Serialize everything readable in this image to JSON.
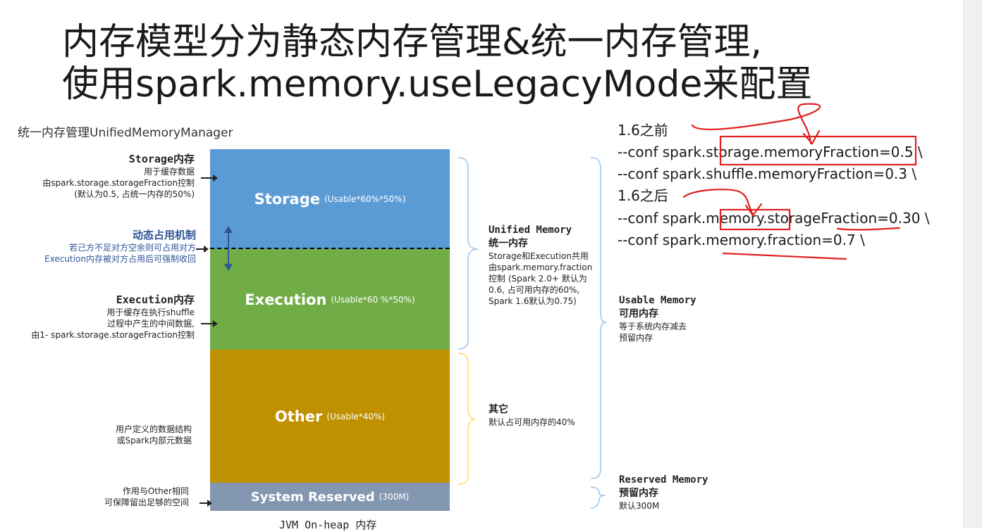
{
  "title": {
    "line1": "内存模型分为静态内存管理&统一内存管理,",
    "line2": "使用spark.memory.useLegacyMode来配置"
  },
  "diagram": {
    "caption": "统一内存管理UnifiedMemoryManager",
    "blocks": {
      "storage": {
        "name": "Storage",
        "note": "(Usable*60%*50%)"
      },
      "execution": {
        "name": "Execution",
        "note": "(Usable*60 %*50%)"
      },
      "other": {
        "name": "Other",
        "note": "(Usable*40%)"
      },
      "reserved": {
        "name": "System Reserved",
        "note": "(300M)"
      }
    },
    "left_labels": {
      "storage": {
        "heading": "Storage内存",
        "line1": "用于缓存数据",
        "line2": "由spark.storage.storageFraction控制",
        "line3": "(默认为0.5, 占统一内存的50%)"
      },
      "dynamic": {
        "heading": "动态占用机制",
        "line1": "若己方不足对方空余则可占用对方",
        "line2": "Execution内存被对方占用后可强制收回"
      },
      "execution": {
        "heading": "Execution内存",
        "line1": "用于缓存在执行shuffle",
        "line2": "过程中产生的中间数据,",
        "line3": "由1- spark.storage.storageFraction控制"
      },
      "other": {
        "line1": "用户定义的数据结构",
        "line2": "或Spark内部元数据"
      },
      "reserved": {
        "line1": "作用与Other相同",
        "line2": "可保障留出足够的空间"
      }
    },
    "right_labels": {
      "unified": {
        "heading1": "Unified Memory",
        "heading2": "统一内存",
        "line1": "Storage和Execution共用",
        "line2": "由spark.memory.fraction",
        "line3": "控制 (Spark 2.0+ 默认为",
        "line4": "0.6, 占可用内存的60%,",
        "line5": "Spark 1.6默认为0.75)"
      },
      "other": {
        "heading": "其它",
        "line1": "默认占可用内存的40%"
      },
      "usable": {
        "heading1": "Usable Memory",
        "heading2": "可用内存",
        "line1": "等于系统内存减去",
        "line2": "预留内存"
      },
      "reserved": {
        "heading1": "Reserved Memory",
        "heading2": "预留内存",
        "line1": "默认300M"
      }
    },
    "bottom_caption": "JVM On-heap 内存"
  },
  "config": {
    "before_heading": "1.6之前",
    "before_lines": [
      "--conf spark.storage.memoryFraction=0.5 \\",
      "--conf spark.shuffle.memoryFraction=0.3 \\"
    ],
    "after_heading": "1.6之后",
    "after_lines": [
      "--conf spark.memory.storageFraction=0.30 \\",
      "--conf spark.memory.fraction=0.7 \\"
    ]
  },
  "colors": {
    "storage": "#5b9bd5",
    "execution": "#70ad47",
    "other": "#bf9000",
    "reserved": "#8497b0",
    "annotation": "#e02020"
  }
}
